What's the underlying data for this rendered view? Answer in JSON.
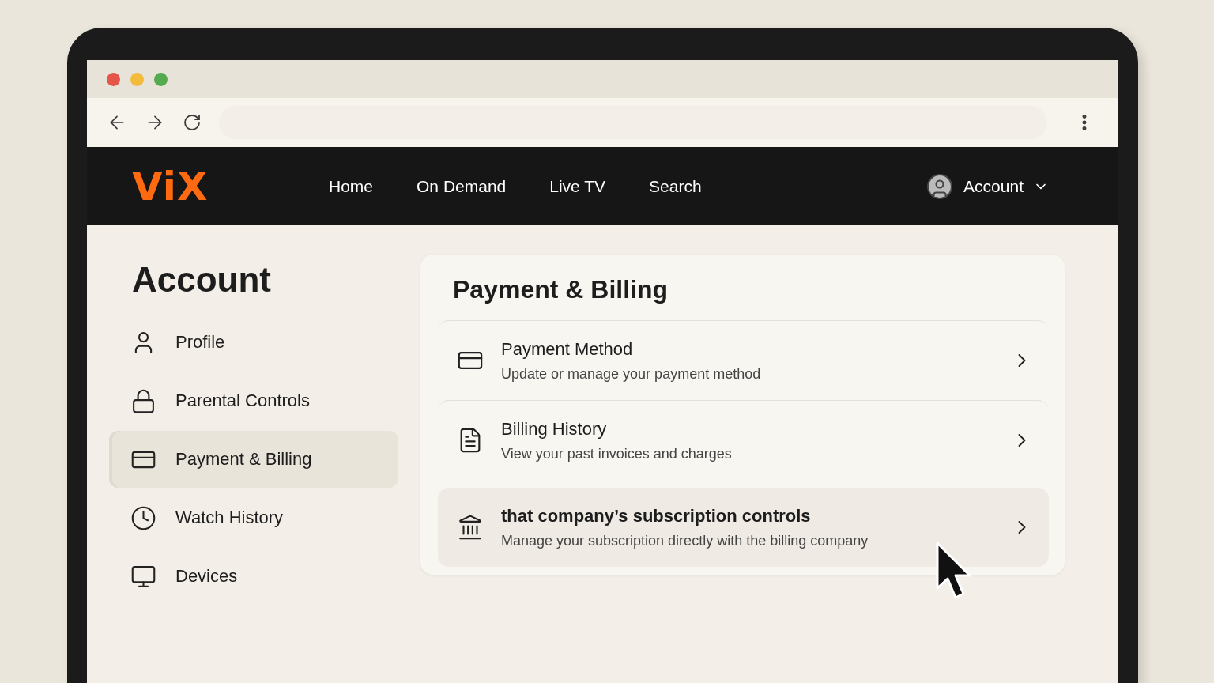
{
  "nav": {
    "logo": "ViX",
    "links": [
      {
        "label": "Home",
        "selected": false
      },
      {
        "label": "On Demand",
        "selected": false
      },
      {
        "label": "Live TV",
        "selected": false
      },
      {
        "label": "Search",
        "selected": false
      }
    ],
    "account": "Account"
  },
  "sidebar": {
    "title": "Account",
    "items": [
      {
        "label": "Profile",
        "selected": false
      },
      {
        "label": "Parental Controls",
        "selected": false
      },
      {
        "label": "Payment & Billing",
        "selected": true
      },
      {
        "label": "Watch History",
        "selected": false
      },
      {
        "label": "Devices",
        "selected": false
      }
    ]
  },
  "panel": {
    "title": "Payment & Billing",
    "rows": [
      {
        "title": "Payment Method",
        "subtitle": "Update or manage your payment method",
        "highlighted": false
      },
      {
        "title": "Billing History",
        "subtitle": "View your past invoices and charges",
        "highlighted": false
      },
      {
        "title": "that company’s subscription controls",
        "subtitle": "Manage your subscription directly with the billing company",
        "highlighted": true
      }
    ]
  }
}
